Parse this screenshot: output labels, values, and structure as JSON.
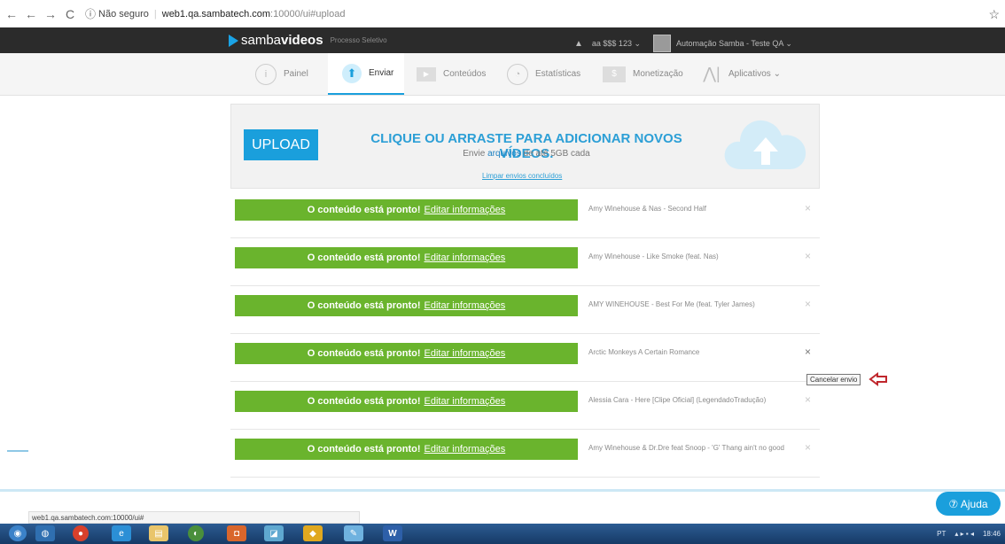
{
  "browser": {
    "nav_back": "←",
    "nav_forward": "→",
    "nav_reload": "C",
    "security": "Não seguro",
    "host": "web1.qa.sambatech.com",
    "path": ":10000/ui#upload"
  },
  "header": {
    "logo_samba": "samba",
    "logo_videos": "videos",
    "logo_sub": "Processo Seletivo",
    "account": "aa $$$ 123 ⌄",
    "user": "Automação Samba - Teste QA ⌄"
  },
  "nav": {
    "tabs": [
      {
        "label": "Painel",
        "icon": "info-circle-icon"
      },
      {
        "label": "Enviar",
        "icon": "upload-arrow-icon"
      },
      {
        "label": "Conteúdos",
        "icon": "play-icon"
      },
      {
        "label": "Estatísticas",
        "icon": "stats-circle-icon"
      },
      {
        "label": "Monetização",
        "icon": "money-icon"
      },
      {
        "label": "Aplicativos ⌄",
        "icon": "apps-icon"
      }
    ]
  },
  "upload": {
    "button": "UPLOAD",
    "title": "CLIQUE OU ARRASTE PARA ADICIONAR NOVOS VÍDEOS.",
    "sub_pre": "Envie ",
    "sub_link": "arquivos",
    "sub_post": " de até 5GB cada",
    "clear": "Limpar envios concluídos"
  },
  "rows": [
    {
      "status": "O conteúdo está pronto!",
      "edit": "Editar informações",
      "name": "Amy Winehouse & Nas - Second Half"
    },
    {
      "status": "O conteúdo está pronto!",
      "edit": "Editar informações",
      "name": "Amy Winehouse - Like Smoke (feat. Nas)"
    },
    {
      "status": "O conteúdo está pronto!",
      "edit": "Editar informações",
      "name": "AMY WINEHOUSE - Best For Me (feat. Tyler James)"
    },
    {
      "status": "O conteúdo está pronto!",
      "edit": "Editar informações",
      "name": "Arctic Monkeys A Certain Romance"
    },
    {
      "status": "O conteúdo está pronto!",
      "edit": "Editar informações",
      "name": "Alessia Cara - Here [Clipe Oficial] (LegendadoTradução)"
    },
    {
      "status": "O conteúdo está pronto!",
      "edit": "Editar informações",
      "name": "Amy Winehouse & Dr.Dre feat Snoop - 'G' Thang ain't no good"
    }
  ],
  "close_glyph": "×",
  "tooltip": "Cancelar envio",
  "help": "⑦ Ajuda",
  "status_url": "web1.qa.sambatech.com:10000/ui#",
  "tray": {
    "lang": "PT",
    "time": "18:46"
  },
  "colors": {
    "accent": "#1a9fdc",
    "success": "#6ab42d",
    "header": "#2b2b2b",
    "arrow": "#c0272d"
  }
}
